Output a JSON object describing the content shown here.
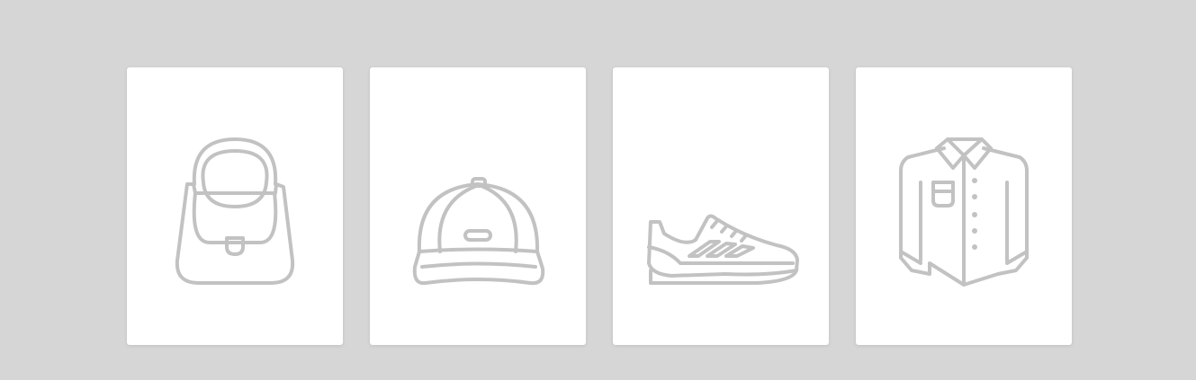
{
  "theme": {
    "background": "#d6d6d6",
    "card_background": "#ffffff",
    "icon_stroke": "#c2c2c2"
  },
  "cards": [
    {
      "icon": "handbag-icon"
    },
    {
      "icon": "cap-icon"
    },
    {
      "icon": "sneaker-icon"
    },
    {
      "icon": "shirt-icon"
    }
  ]
}
